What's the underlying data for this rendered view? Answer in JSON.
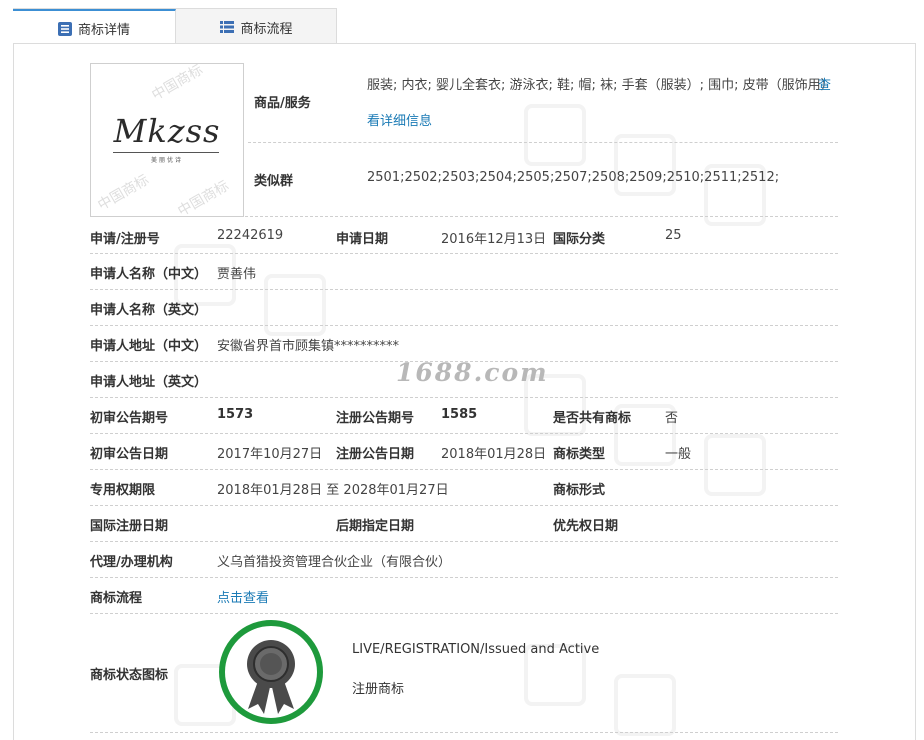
{
  "tabs": [
    {
      "label": "商标详情",
      "icon": "list-icon"
    },
    {
      "label": "商标流程",
      "icon": "table-icon"
    }
  ],
  "watermark": "1688.com",
  "logo": {
    "text": "Mkzss",
    "sub": "美丽优诗",
    "wm": "中国商标"
  },
  "goods": {
    "label": "商品/服务",
    "value": "服装; 内衣; 婴儿全套衣; 游泳衣; 鞋; 帽; 袜; 手套（服装）; 围巾; 皮带（服饰用）",
    "more": "查",
    "more2": "看详细信息"
  },
  "similar": {
    "label": "类似群",
    "value": "2501;2502;2503;2504;2505;2507;2508;2509;2510;2511;2512;"
  },
  "fields": {
    "reg_no_label": "申请/注册号",
    "reg_no": "22242619",
    "apply_date_label": "申请日期",
    "apply_date": "2016年12月13日",
    "intl_class_label": "国际分类",
    "intl_class": "25",
    "applicant_cn_label": "申请人名称（中文）",
    "applicant_cn": "贾善伟",
    "applicant_en_label": "申请人名称（英文）",
    "applicant_en": "",
    "address_cn_label": "申请人地址（中文）",
    "address_cn": "安徽省界首市顾集镇**********",
    "address_en_label": "申请人地址（英文）",
    "address_en": "",
    "prelim_no_label": "初审公告期号",
    "prelim_no": "1573",
    "reg_pub_no_label": "注册公告期号",
    "reg_pub_no": "1585",
    "shared_label": "是否共有商标",
    "shared": "否",
    "prelim_date_label": "初审公告日期",
    "prelim_date": "2017年10月27日",
    "reg_pub_date_label": "注册公告日期",
    "reg_pub_date": "2018年01月28日",
    "mark_type_label": "商标类型",
    "mark_type": "一般",
    "term_label": "专用权期限",
    "term": "2018年01月28日 至 2028年01月27日",
    "mark_form_label": "商标形式",
    "mark_form": "",
    "intl_reg_date_label": "国际注册日期",
    "intl_reg_date": "",
    "later_date_label": "后期指定日期",
    "later_date": "",
    "priority_date_label": "优先权日期",
    "priority_date": "",
    "agent_label": "代理/办理机构",
    "agent": "义乌首猎投资管理合伙企业（有限合伙）",
    "flow_label": "商标流程",
    "flow_link": "点击查看",
    "status_label": "商标状态图标",
    "status_en": "LIVE/REGISTRATION/Issued and Active",
    "status_cn": "注册商标"
  },
  "colors": {
    "accent": "#3c8fd4",
    "link": "#1a7ab5",
    "status_ring": "#1e9a3c",
    "medal": "#4a4a4a"
  }
}
